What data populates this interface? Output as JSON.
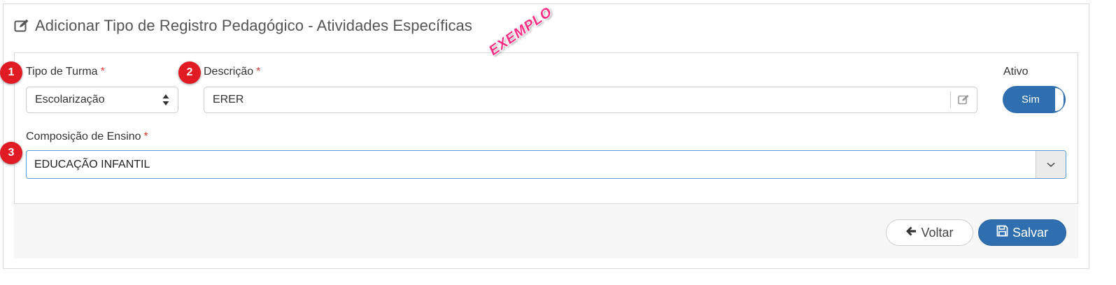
{
  "page": {
    "title": "Adicionar Tipo de Registro Pedagógico - Atividades Específicas",
    "title_icon": "edit-icon"
  },
  "watermark": "EXEMPLO",
  "badges": [
    "1",
    "2",
    "3"
  ],
  "form": {
    "tipo_turma": {
      "label": "Tipo de Turma",
      "required_mark": "*",
      "value": "Escolarização"
    },
    "descricao": {
      "label": "Descrição",
      "required_mark": "*",
      "value": "ERER",
      "icon": "edit-icon"
    },
    "ativo": {
      "label": "Ativo",
      "toggle_text": "Sim",
      "on": true
    },
    "composicao": {
      "label": "Composição de Ensino",
      "required_mark": "*",
      "value": "EDUCAÇÃO INFANTIL"
    }
  },
  "actions": {
    "back_label": "Voltar",
    "save_label": "Salvar"
  },
  "colors": {
    "primary": "#2f6fb0",
    "badge": "#e01b24",
    "required": "#d9383a",
    "watermark": "#ff2f86"
  }
}
